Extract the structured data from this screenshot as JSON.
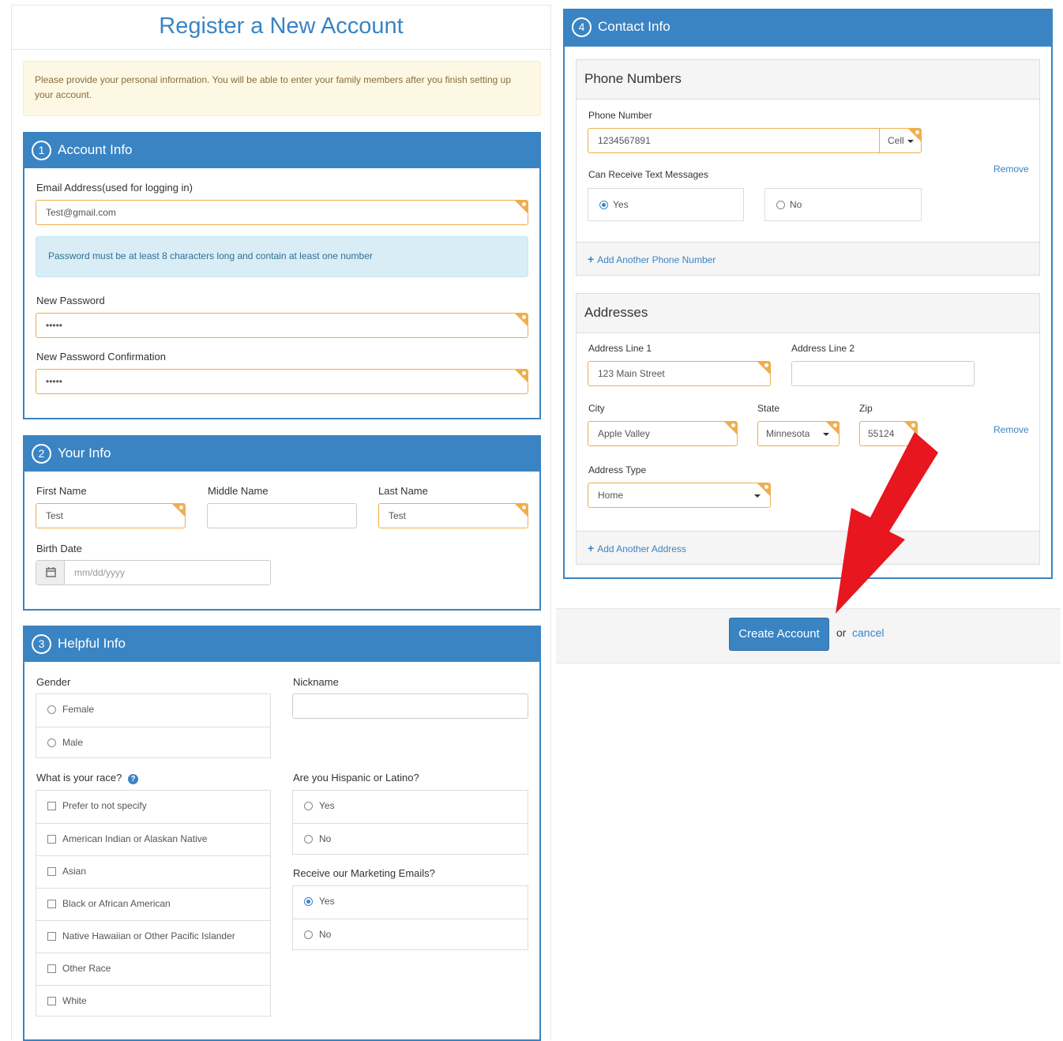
{
  "page": {
    "title": "Register a New Account",
    "intro": "Please provide your personal information. You will be able to enter your family members after you finish setting up your account."
  },
  "account": {
    "step": "1",
    "title": "Account Info",
    "email_label": "Email Address(used for logging in)",
    "email_value": "Test@gmail.com",
    "password_hint": "Password must be at least 8 characters long and contain at least one number",
    "password_label": "New Password",
    "password_value": "•••••",
    "confirm_label": "New Password Confirmation",
    "confirm_value": "•••••"
  },
  "your_info": {
    "step": "2",
    "title": "Your Info",
    "first_label": "First Name",
    "first_value": "Test",
    "middle_label": "Middle Name",
    "middle_value": "",
    "last_label": "Last Name",
    "last_value": "Test",
    "birth_label": "Birth Date",
    "birth_placeholder": "mm/dd/yyyy"
  },
  "helpful": {
    "step": "3",
    "title": "Helpful Info",
    "gender_label": "Gender",
    "gender_options": [
      {
        "label": "Female",
        "checked": false
      },
      {
        "label": "Male",
        "checked": false
      }
    ],
    "nickname_label": "Nickname",
    "nickname_value": "",
    "race_label": "What is your race?",
    "race_options": [
      "Prefer to not specify",
      "American Indian or Alaskan Native",
      "Asian",
      "Black or African American",
      "Native Hawaiian or Other Pacific Islander",
      "Other Race",
      "White"
    ],
    "hispanic_label": "Are you Hispanic or Latino?",
    "hispanic_options": [
      {
        "label": "Yes",
        "checked": false
      },
      {
        "label": "No",
        "checked": false
      }
    ],
    "marketing_label": "Receive our Marketing Emails?",
    "marketing_options": [
      {
        "label": "Yes",
        "checked": true
      },
      {
        "label": "No",
        "checked": false
      }
    ]
  },
  "contact": {
    "step": "4",
    "title": "Contact Info",
    "phones": {
      "title": "Phone Numbers",
      "number_label": "Phone Number",
      "number_value": "1234567891",
      "type_value": "Cell",
      "text_label": "Can Receive Text Messages",
      "text_yes": "Yes",
      "text_no": "No",
      "text_selected": "Yes",
      "remove_label": "Remove",
      "add_label": "Add Another Phone Number"
    },
    "addresses": {
      "title": "Addresses",
      "line1_label": "Address Line 1",
      "line1_value": "123 Main Street",
      "line2_label": "Address Line 2",
      "line2_value": "",
      "city_label": "City",
      "city_value": "Apple Valley",
      "state_label": "State",
      "state_value": "Minnesota",
      "zip_label": "Zip",
      "zip_value": "55124",
      "type_label": "Address Type",
      "type_value": "Home",
      "remove_label": "Remove",
      "add_label": "Add Another Address"
    }
  },
  "actions": {
    "create_label": "Create Account",
    "or_text": "or",
    "cancel_label": "cancel"
  },
  "colors": {
    "primary": "#3a84c4",
    "required_border": "#f0ad4e",
    "arrow": "#e8161e"
  }
}
